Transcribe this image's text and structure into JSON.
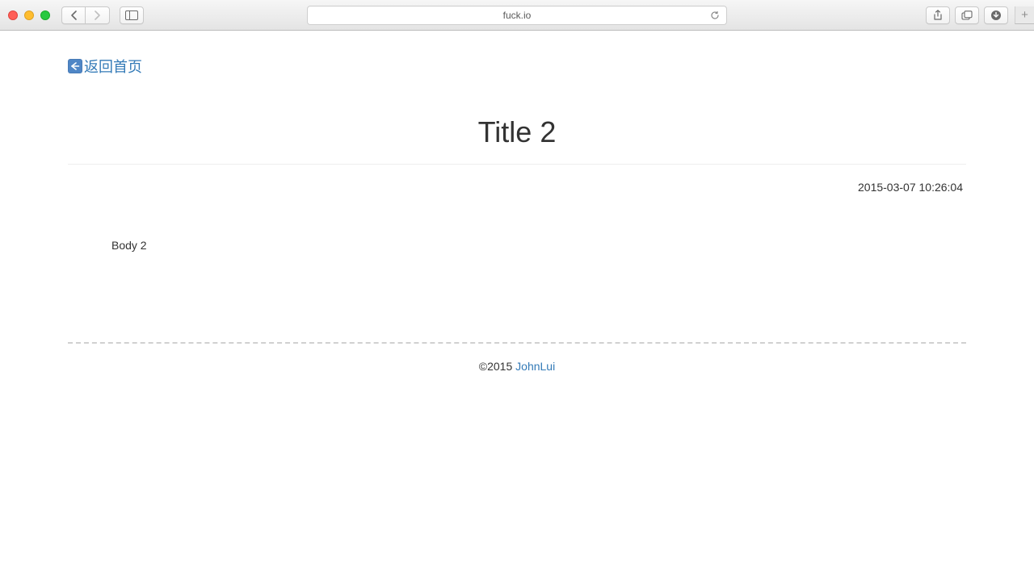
{
  "browser": {
    "url": "fuck.io"
  },
  "nav": {
    "back_label": "返回首页"
  },
  "article": {
    "title": "Title 2",
    "date": "2015-03-07 10:26:04",
    "body": "Body 2"
  },
  "footer": {
    "copyright": "©2015 ",
    "author": "JohnLui"
  }
}
